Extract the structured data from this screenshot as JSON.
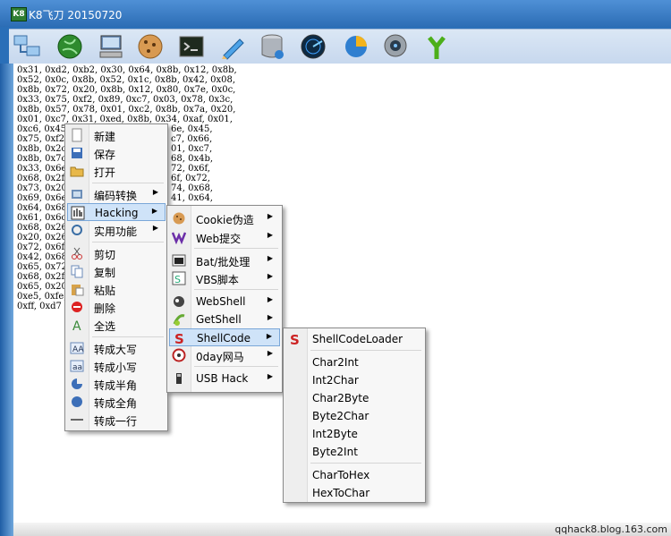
{
  "window": {
    "title": "K8飞刀 20150720",
    "app_icon_text": "K8"
  },
  "toolbar": {
    "buttons": [
      {
        "icon": "network-computers-icon"
      },
      {
        "icon": "green-globe-icon"
      },
      {
        "icon": "computer-icon"
      },
      {
        "icon": "cookie-icon"
      },
      {
        "icon": "terminal-icon"
      },
      {
        "icon": "pencil-icon"
      },
      {
        "icon": "database-icon"
      },
      {
        "icon": "radar-icon"
      },
      {
        "icon": "pie-chart-icon"
      },
      {
        "icon": "webcam-icon"
      },
      {
        "icon": "network-branch-icon"
      }
    ]
  },
  "editor": {
    "lines": [
      "0x31, 0xd2, 0xb2, 0x30, 0x64, 0x8b, 0x12, 0x8b,",
      "0x52, 0x0c, 0x8b, 0x52, 0x1c, 0x8b, 0x42, 0x08,",
      "0x8b, 0x72, 0x20, 0x8b, 0x12, 0x80, 0x7e, 0x0c,",
      "0x33, 0x75, 0xf2, 0x89, 0xc7, 0x03, 0x78, 0x3c,",
      "0x8b, 0x57, 0x78, 0x01, 0xc2, 0x8b, 0x7a, 0x20,",
      "0x01, 0xc7, 0x31, 0xed, 0x8b, 0x34, 0xaf, 0x01,",
      "0xc6, 0x45,",
      "0x75, 0xf2,",
      "0x8b, 0x2c,",
      "0x8b, 0x7c,",
      "0x33, 0x6e,",
      "0x68, 0x2f,",
      "0x73, 0x20,",
      "0x69, 0x6e,",
      "0x64, 0x68,",
      "0x61, 0x6c,",
      "0x68, 0x26,",
      "0x20, 0x26,",
      "0x72, 0x6f,",
      "0x42, 0x68,",
      "0x65, 0x72,",
      "0x68, 0x2f,",
      "0x65, 0x20,",
      "0xe5, 0xfe,",
      "0xff, 0xd7"
    ],
    "right_fragments": [
      {
        "line": 6,
        "text": "6e, 0x45,"
      },
      {
        "line": 7,
        "text": "c7, 0x66,"
      },
      {
        "line": 8,
        "text": "01, 0xc7,"
      },
      {
        "line": 9,
        "text": "68, 0x4b,"
      },
      {
        "line": 10,
        "text": "72, 0x6f,"
      },
      {
        "line": 11,
        "text": "6f, 0x72,"
      },
      {
        "line": 12,
        "text": "74, 0x68,"
      },
      {
        "line": 13,
        "text": "41, 0x64,"
      }
    ]
  },
  "context_menu": {
    "items": [
      {
        "label": "新建",
        "icon": "new-file-icon",
        "arrow": false
      },
      {
        "label": "保存",
        "icon": "save-icon",
        "arrow": false
      },
      {
        "label": "打开",
        "icon": "open-folder-icon",
        "arrow": false
      },
      {
        "label": "编码转换",
        "icon": "encode-icon",
        "arrow": true
      },
      {
        "label": "Hacking",
        "icon": "hacking-icon",
        "arrow": true,
        "selected": true
      },
      {
        "label": "实用功能",
        "icon": "tools-icon",
        "arrow": true
      },
      {
        "label": "剪切",
        "icon": "cut-icon",
        "arrow": false
      },
      {
        "label": "复制",
        "icon": "copy-icon",
        "arrow": false
      },
      {
        "label": "粘贴",
        "icon": "paste-icon",
        "arrow": false
      },
      {
        "label": "删除",
        "icon": "delete-icon",
        "arrow": false
      },
      {
        "label": "全选",
        "icon": "select-all-icon",
        "arrow": false
      },
      {
        "label": "转成大写",
        "icon": "uppercase-icon",
        "arrow": false
      },
      {
        "label": "转成小写",
        "icon": "lowercase-icon",
        "arrow": false
      },
      {
        "label": "转成半角",
        "icon": "halfwidth-icon",
        "arrow": false
      },
      {
        "label": "转成全角",
        "icon": "fullwidth-icon",
        "arrow": false
      },
      {
        "label": "转成一行",
        "icon": "one-line-icon",
        "arrow": false
      }
    ]
  },
  "hacking_menu": {
    "items": [
      {
        "label": "Cookie伪造",
        "icon": "cookie-icon"
      },
      {
        "label": "Web提交",
        "icon": "web-submit-icon"
      },
      {
        "label": "Bat/批处理",
        "icon": "batch-icon"
      },
      {
        "label": "VBS脚本",
        "icon": "vbs-icon"
      },
      {
        "label": "WebShell",
        "icon": "webshell-icon"
      },
      {
        "label": "GetShell",
        "icon": "getshell-icon"
      },
      {
        "label": "ShellCode",
        "icon": "shellcode-icon",
        "selected": true
      },
      {
        "label": "0day网马",
        "icon": "0day-icon"
      },
      {
        "label": "USB Hack",
        "icon": "usb-icon"
      }
    ]
  },
  "shellcode_menu": {
    "items": [
      {
        "label": "ShellCodeLoader",
        "icon": "shellcode-icon"
      },
      {
        "label": "Char2Int"
      },
      {
        "label": "Int2Char"
      },
      {
        "label": "Char2Byte"
      },
      {
        "label": "Byte2Char"
      },
      {
        "label": "Int2Byte"
      },
      {
        "label": "Byte2Int"
      },
      {
        "label": "CharToHex"
      },
      {
        "label": "HexToChar"
      }
    ]
  },
  "status": {
    "text": "qqhack8.blog.163.com"
  },
  "colors": {
    "menu_highlight": "#cfe3f8",
    "menu_highlight_border": "#7aa7d8",
    "title_bar": "#2c6db5"
  }
}
